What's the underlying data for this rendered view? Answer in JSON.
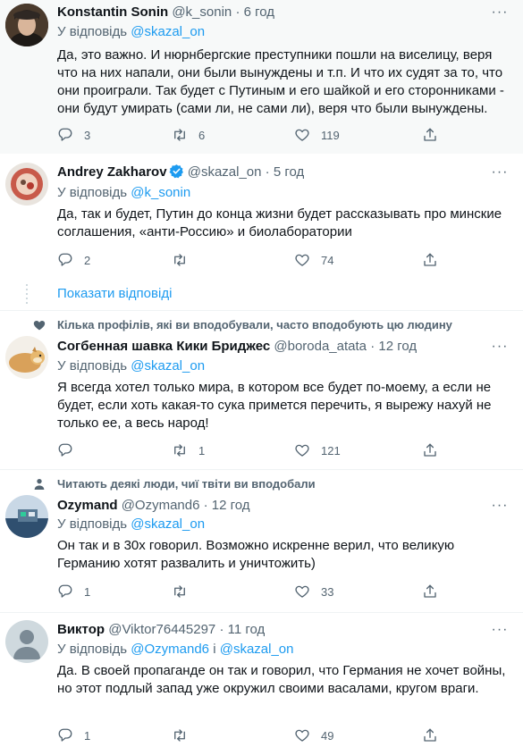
{
  "tweets": [
    {
      "name": "Konstantin Sonin",
      "handle": "@k_sonin",
      "time": "6 год",
      "reply_prefix": "У відповідь",
      "reply_to": "@skazal_on",
      "text": "Да, это важно. И нюрнбергские преступники пошли на виселицу, веря что на них напали, они были вынуждены и т.п. И что их судят за то, что они проиграли. Так будет с Путиным и его шайкой и его сторонниками - они будут умирать (сами ли, не сами ли), веря что были вынуждены.",
      "replies": "3",
      "retweets": "6",
      "likes": "119"
    },
    {
      "name": "Andrey Zakharov",
      "handle": "@skazal_on",
      "time": "5 год",
      "reply_prefix": "У відповідь",
      "reply_to": "@k_sonin",
      "text": "Да, так и будет, Путин до конца жизни будет рассказывать про минские соглашения, «анти-Россию» и биолаборатории",
      "replies": "2",
      "retweets": "",
      "likes": "74",
      "show_replies": "Показати відповіді"
    },
    {
      "social_context": "Кілька профілів, які ви вподобували, часто вподобують цю людину",
      "name": "Согбенная шавка Кики Бриджес",
      "handle": "@boroda_atata",
      "time": "12 год",
      "reply_prefix": "У відповідь",
      "reply_to": "@skazal_on",
      "text": "Я всегда хотел только мира, в котором все будет по-моему, а если не будет, если хоть какая-то сука примется перечить, я вырежу нахуй не только ее, а весь народ!",
      "replies": "",
      "retweets": "1",
      "likes": "121"
    },
    {
      "social_context": "Читають деякі люди, чиї твіти ви вподобали",
      "name": "Ozymand",
      "handle": "@Ozymand6",
      "time": "12 год",
      "reply_prefix": "У відповідь",
      "reply_to": "@skazal_on",
      "text": "Он так и в 30х говорил. Возможно искренне верил, что великую Германию хотят развалить и уничтожить)",
      "replies": "1",
      "retweets": "",
      "likes": "33"
    },
    {
      "name": "Виктор",
      "handle": "@Viktor76445297",
      "time": "11 год",
      "reply_prefix": "У відповідь",
      "reply_to": "@Ozymand6",
      "reply_and": "і",
      "reply_to2": "@skazal_on",
      "text": "Да. В своей пропаганде он так и говорил, что Германия не хочет войны, но этот подлый запад уже окружил своими васалами, кругом враги.",
      "replies": "1",
      "retweets": "",
      "likes": "49"
    }
  ],
  "sep": "·",
  "more_glyph": "···",
  "colors": {
    "accent": "#1d9bf0",
    "muted": "#536471",
    "text": "#0f1419"
  }
}
